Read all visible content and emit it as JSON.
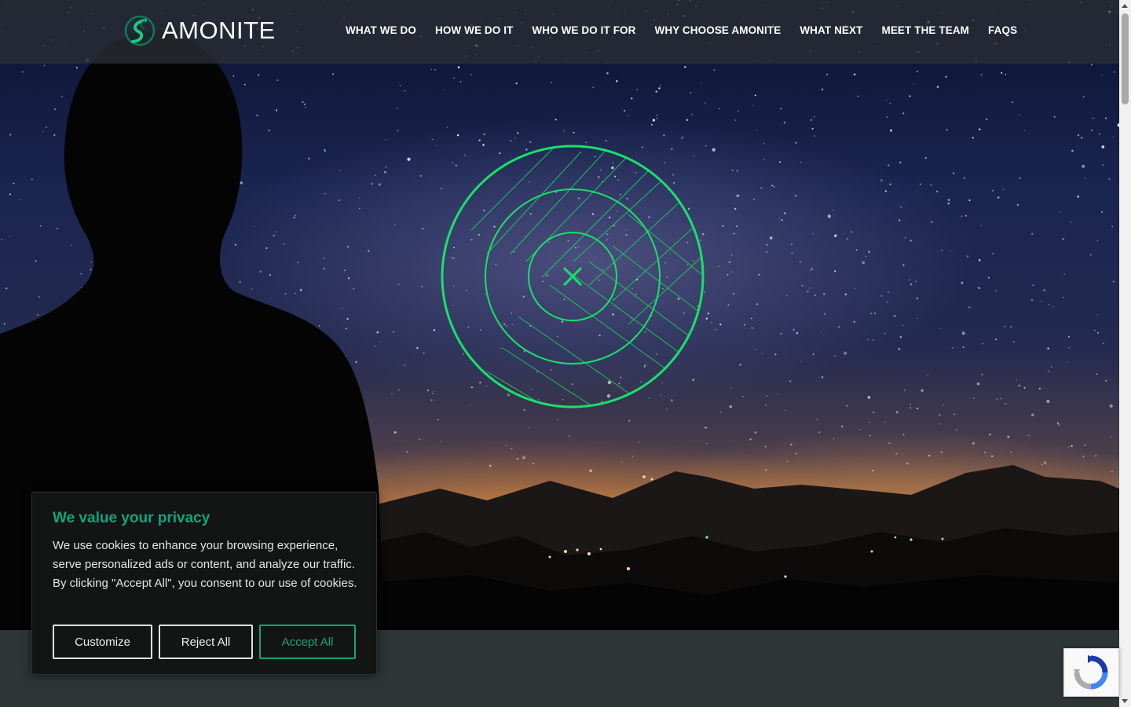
{
  "brand": {
    "name": "AMONITE",
    "accent": "#12a47a",
    "target_color": "#19e06a"
  },
  "nav": {
    "items": [
      {
        "label": "WHAT WE DO"
      },
      {
        "label": "HOW WE DO IT"
      },
      {
        "label": "WHO WE DO IT FOR"
      },
      {
        "label": "WHY CHOOSE AMONITE"
      },
      {
        "label": "WHAT NEXT"
      },
      {
        "label": "MEET THE TEAM"
      },
      {
        "label": "FAQS"
      }
    ]
  },
  "cookie_banner": {
    "title": "We value your privacy",
    "body": "We use cookies to enhance your browsing experience, serve personalized ads or content, and analyze our traffic. By clicking \"Accept All\", you consent to our use of cookies.",
    "customize_label": "Customize",
    "reject_label": "Reject All",
    "accept_label": "Accept All"
  },
  "icons": {
    "logo": "amonite-spiral-logo-icon",
    "target": "crosshair-target-icon",
    "recaptcha": "recaptcha-icon"
  }
}
